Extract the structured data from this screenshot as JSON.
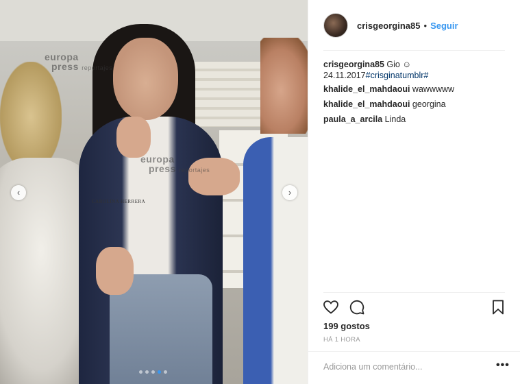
{
  "photo": {
    "watermarks": [
      {
        "line1": "europa",
        "line2": "press",
        "tag": "reportajes"
      },
      {
        "line1": "europa",
        "line2": "press",
        "tag": "reportajes"
      }
    ],
    "shirt_text": "CAROLINA HERRERA",
    "carousel": {
      "total": 5,
      "active_index": 3
    },
    "prev_icon": "chevron-left-icon",
    "next_icon": "chevron-right-icon"
  },
  "post": {
    "username": "crisgeorgina85",
    "separator": "•",
    "follow_label": "Seguir",
    "caption": {
      "user": "crisgeorgina85",
      "text": "Gio ☺",
      "date": "24.11.2017",
      "hashtag": "#crisginatumblr#"
    },
    "comments": [
      {
        "user": "khalide_el_mahdaoui",
        "text": "wawwwww"
      },
      {
        "user": "khalide_el_mahdaoui",
        "text": "georgina"
      },
      {
        "user": "paula_a_arcila",
        "text": "Linda"
      }
    ],
    "likes": "199 gostos",
    "time_ago": "HÁ 1 HORA",
    "comment_placeholder": "Adiciona um comentário...",
    "more_label": "•••",
    "icons": {
      "like": "heart-icon",
      "comment": "comment-icon",
      "save": "bookmark-icon"
    }
  }
}
